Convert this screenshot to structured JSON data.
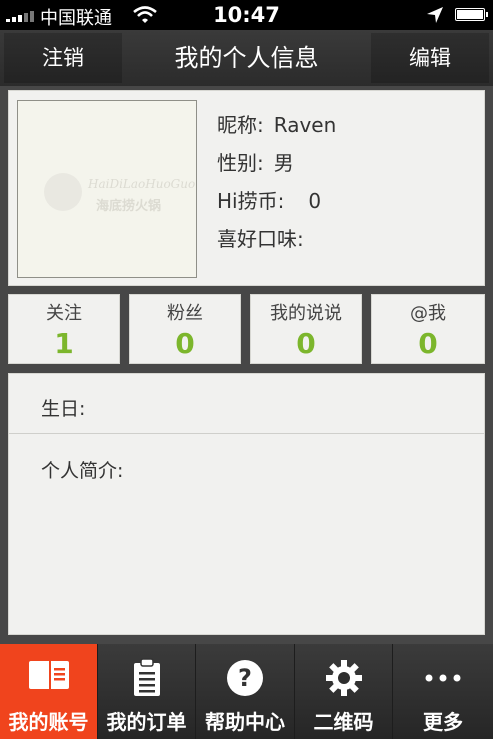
{
  "status_bar": {
    "carrier": "中国联通",
    "time": "10:47"
  },
  "nav": {
    "left_button": "注销",
    "title": "我的个人信息",
    "right_button": "编辑"
  },
  "profile": {
    "avatar_logo_text": "HaiDiLaoHuoGuo",
    "avatar_logo_cn": "海底捞火锅",
    "nickname_label": "昵称:",
    "nickname": "Raven",
    "gender_label": "性别:",
    "gender": "男",
    "coins_label": "Hi捞币:",
    "coins": "0",
    "taste_label": "喜好口味:",
    "taste": ""
  },
  "stats": [
    {
      "label": "关注",
      "value": "1"
    },
    {
      "label": "粉丝",
      "value": "0"
    },
    {
      "label": "我的说说",
      "value": "0"
    },
    {
      "label": "@我",
      "value": "0"
    }
  ],
  "details": {
    "birthday_label": "生日:",
    "bio_label": "个人简介:"
  },
  "tabs": [
    {
      "label": "我的账号",
      "icon": "account-card-icon",
      "active": true
    },
    {
      "label": "我的订单",
      "icon": "clipboard-icon",
      "active": false
    },
    {
      "label": "帮助中心",
      "icon": "question-icon",
      "active": false
    },
    {
      "label": "二维码",
      "icon": "gear-icon",
      "active": false
    },
    {
      "label": "更多",
      "icon": "more-dots-icon",
      "active": false
    }
  ],
  "colors": {
    "accent": "#f0441d",
    "stat_number": "#7cb62c"
  }
}
